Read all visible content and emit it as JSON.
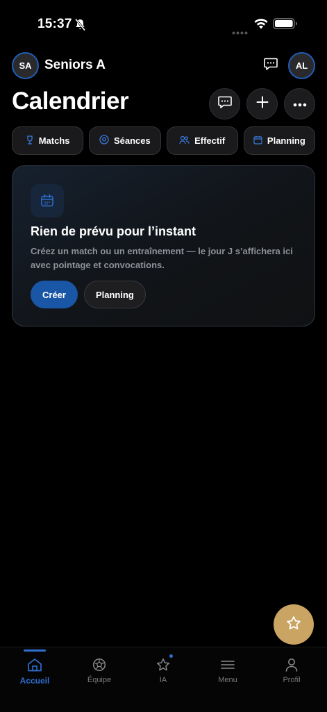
{
  "status": {
    "time": "15:37"
  },
  "header": {
    "team_initials": "SA",
    "team_name": "Seniors A",
    "user_initials": "AL"
  },
  "page": {
    "title": "Calendrier"
  },
  "filters": [
    {
      "label": "Matchs",
      "icon": "trophy-icon"
    },
    {
      "label": "Séances",
      "icon": "ball-icon"
    },
    {
      "label": "Effectif",
      "icon": "users-icon"
    },
    {
      "label": "Planning",
      "icon": "calendar-icon"
    }
  ],
  "empty_state": {
    "title": "Rien de prévu pour l’instant",
    "text": "Créez un match ou un entraînement — le jour J s’affichera ici avec pointage et convocations.",
    "primary_label": "Créer",
    "secondary_label": "Planning"
  },
  "tabs": [
    {
      "label": "Accueil",
      "icon": "home-icon",
      "active": true
    },
    {
      "label": "Équipe",
      "icon": "ball-icon"
    },
    {
      "label": "IA",
      "icon": "star-icon"
    },
    {
      "label": "Menu",
      "icon": "menu-icon"
    },
    {
      "label": "Profil",
      "icon": "person-icon"
    }
  ],
  "colors": {
    "accent": "#2e6fd1",
    "primary_button": "#1a56a6",
    "fab": "#c9a463",
    "background": "#000000"
  }
}
